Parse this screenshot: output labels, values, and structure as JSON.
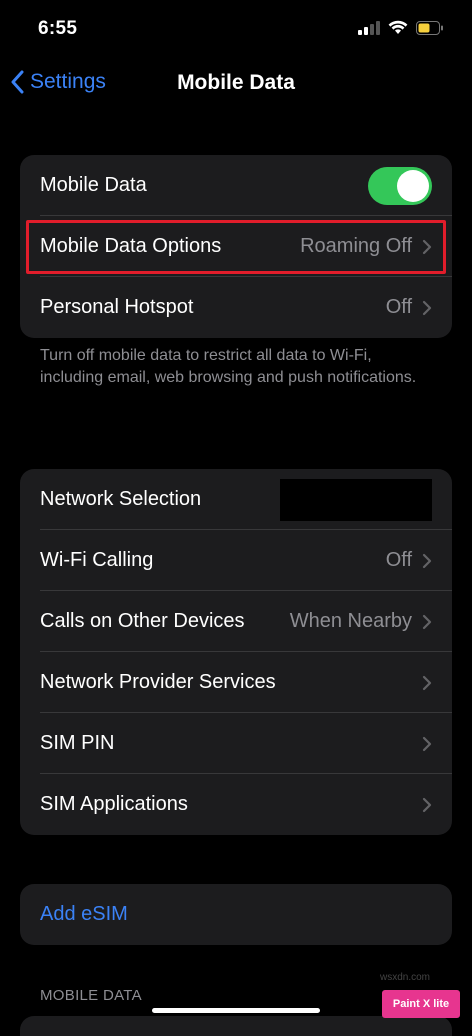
{
  "status": {
    "time": "6:55"
  },
  "nav": {
    "back_label": "Settings",
    "title": "Mobile Data"
  },
  "group1": {
    "mobile_data": {
      "label": "Mobile Data",
      "enabled": true
    },
    "options": {
      "label": "Mobile Data Options",
      "value": "Roaming Off"
    },
    "hotspot": {
      "label": "Personal Hotspot",
      "value": "Off"
    }
  },
  "footnote": "Turn off mobile data to restrict all data to Wi-Fi, including email, web browsing and push notifications.",
  "group2": [
    {
      "label": "Network Selection",
      "value": ""
    },
    {
      "label": "Wi-Fi Calling",
      "value": "Off"
    },
    {
      "label": "Calls on Other Devices",
      "value": "When Nearby"
    },
    {
      "label": "Network Provider Services",
      "value": ""
    },
    {
      "label": "SIM PIN",
      "value": ""
    },
    {
      "label": "SIM Applications",
      "value": ""
    }
  ],
  "esim": {
    "label": "Add eSIM"
  },
  "section_header": "MOBILE DATA",
  "watermark": {
    "brand": "Paint X lite",
    "site": "wsxdn.com"
  },
  "colors": {
    "accent": "#3b82f6",
    "toggle_on": "#34c759",
    "highlight": "#e11d2b"
  }
}
